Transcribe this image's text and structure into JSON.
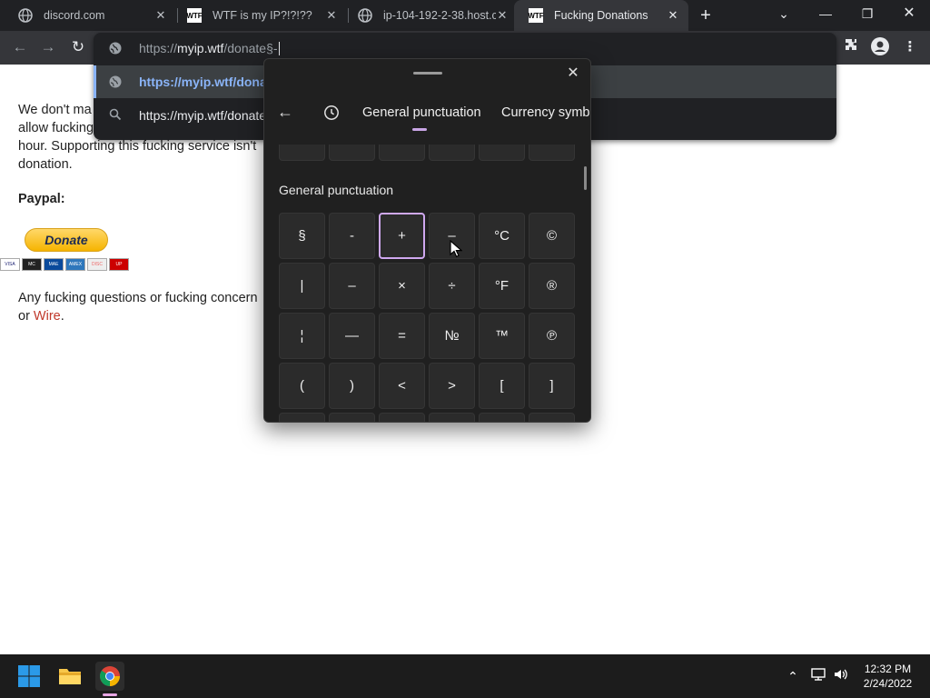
{
  "tabs": [
    {
      "title": "discord.com",
      "favicon": "globe-icon"
    },
    {
      "title": "WTF is my IP?!?!??",
      "favicon": "wtf-icon"
    },
    {
      "title": "ip-104-192-2-38.host.c",
      "favicon": "globe-icon"
    },
    {
      "title": "Fucking Donations",
      "favicon": "wtf-icon",
      "active": true
    }
  ],
  "favicon_text": "WTF",
  "omnibox": {
    "url_prefix": "https://",
    "url_host": "myip.wtf",
    "url_rest": "/donate§-",
    "suggestions": [
      {
        "text": "https://myip.wtf/donate",
        "icon": "globe-icon",
        "selected": true
      },
      {
        "text": "https://myip.wtf/donate",
        "icon": "search-icon"
      }
    ]
  },
  "page": {
    "para1": [
      "We don't ma",
      "allow fucking",
      "hour. Supporting this fucking service isn't",
      "donation."
    ],
    "paypal_label": "Paypal:",
    "donate_label": "Donate",
    "cards": [
      "VISA",
      "MC",
      "MAE",
      "AMEX",
      "DISC",
      "UP"
    ],
    "para2_line1": "Any fucking questions or fucking concern",
    "para2_or": "or ",
    "para2_wire": "Wire",
    "para2_end": "."
  },
  "symbol_panel": {
    "tabs": [
      "General punctuation",
      "Currency symbo"
    ],
    "section_title": "General punctuation",
    "rows": [
      [
        "§",
        "-",
        "+",
        "–",
        "°C",
        "©"
      ],
      [
        "|",
        "–",
        "×",
        "÷",
        "°F",
        "®"
      ],
      [
        "¦",
        "—",
        "=",
        "№",
        "™",
        "℗"
      ],
      [
        "(",
        ")",
        "<",
        ">",
        "[",
        "]"
      ]
    ],
    "selected_cell": [
      0,
      2
    ]
  },
  "taskbar": {
    "time": "12:32 PM",
    "date": "2/24/2022"
  },
  "colors": {
    "accent": "#8ab4f8",
    "link_red": "#c0392b",
    "panel_select": "#cfa8f0"
  }
}
